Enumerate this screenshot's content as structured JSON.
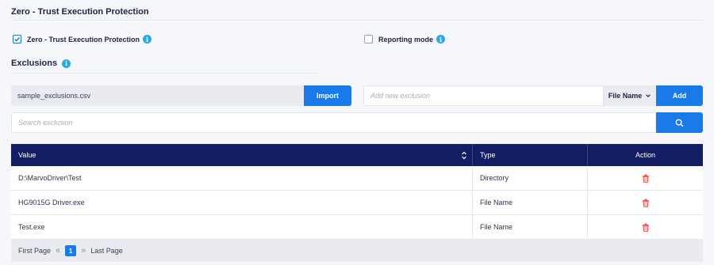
{
  "section": {
    "title": "Zero - Trust Execution Protection"
  },
  "options": {
    "ztep_label": "Zero - Trust Execution Protection",
    "ztep_checked": true,
    "reporting_label": "Reporting mode",
    "reporting_checked": false
  },
  "exclusions": {
    "title": "Exclusions",
    "file_name": "sample_exclusions.csv",
    "import_label": "Import",
    "add_placeholder": "Add new exclusion",
    "type_select": "File Name",
    "add_label": "Add",
    "search_placeholder": "Search exclusion"
  },
  "table": {
    "headers": {
      "value": "Value",
      "type": "Type",
      "action": "Action"
    },
    "rows": [
      {
        "value": "D:\\MarvoDriver\\Test",
        "type": "Directory"
      },
      {
        "value": "HG9015G Driver.exe",
        "type": "File Name"
      },
      {
        "value": "Test.exe",
        "type": "File Name"
      }
    ]
  },
  "pager": {
    "first": "First Page",
    "current": "1",
    "last": "Last Page"
  },
  "colors": {
    "accent": "#1a7ae8",
    "header_bg": "#121d63",
    "info": "#29a9e0",
    "delete": "#e85a5a"
  }
}
